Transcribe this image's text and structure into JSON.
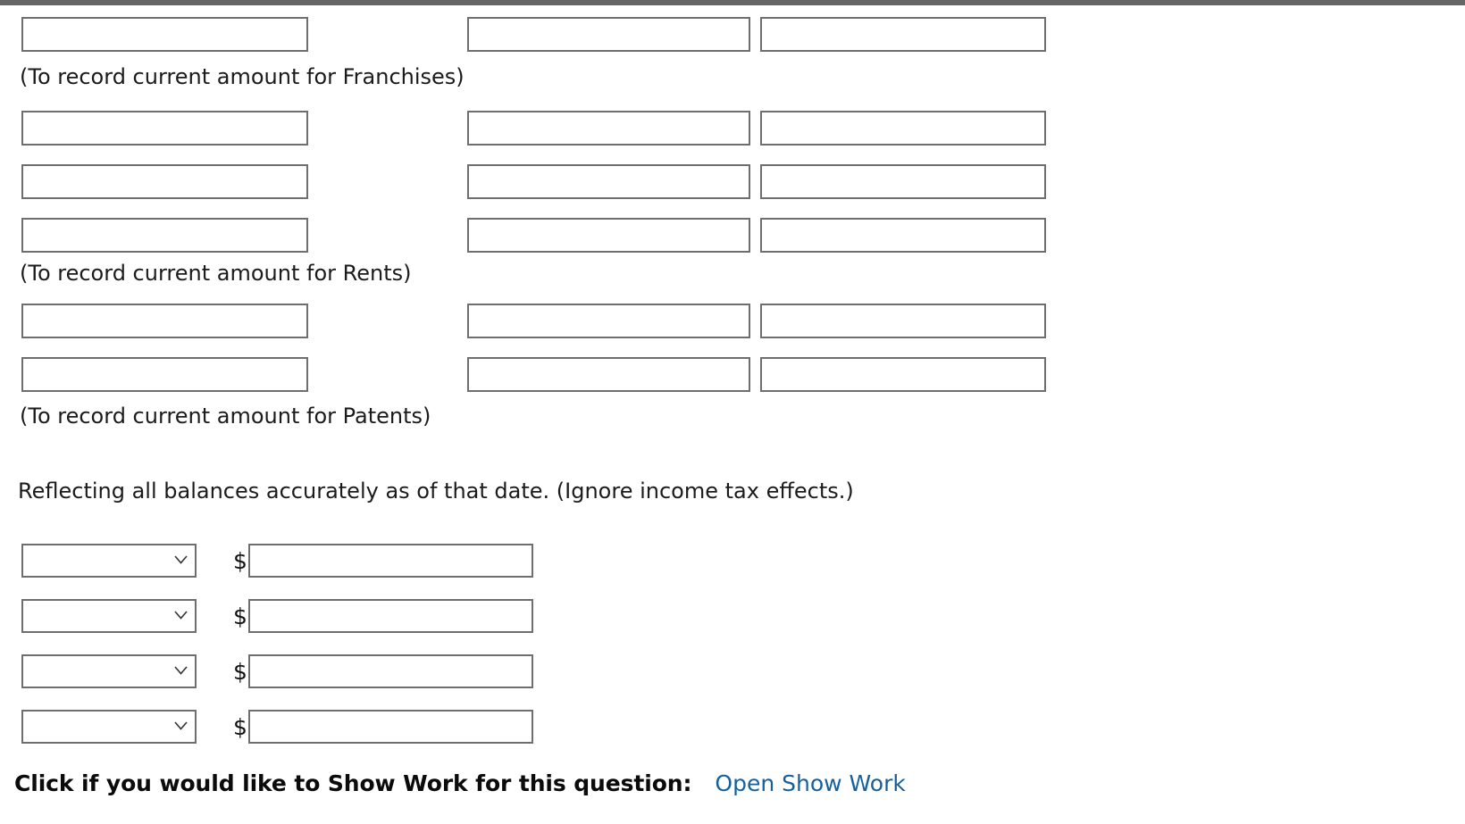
{
  "theme": {
    "top_bar_color": "#666666",
    "field_border_color": "#6e6e6e",
    "page_background": "#ffffff",
    "text_color": "#1b1b1b",
    "link_color": "#16619d"
  },
  "journal": {
    "columns": [
      "account",
      "debit",
      "credit"
    ],
    "groups": [
      {
        "id": "franchises",
        "rows": [
          {
            "account": "",
            "debit": "",
            "credit": ""
          }
        ],
        "caption": "(To record current amount for Franchises)"
      },
      {
        "id": "rents",
        "rows": [
          {
            "account": "",
            "debit": "",
            "credit": ""
          },
          {
            "account": "",
            "debit": "",
            "credit": ""
          },
          {
            "account": "",
            "debit": "",
            "credit": ""
          }
        ],
        "caption": "(To record current amount for Rents)"
      },
      {
        "id": "patents",
        "rows": [
          {
            "account": "",
            "debit": "",
            "credit": ""
          },
          {
            "account": "",
            "debit": "",
            "credit": ""
          }
        ],
        "caption": "(To record current amount for Patents)"
      }
    ]
  },
  "narrative": {
    "text": "Reflecting all balances accurately as of that date. (Ignore income tax effects.)"
  },
  "balance_section": {
    "currency_symbol": "$",
    "select_placeholder": "",
    "rows": [
      {
        "category": "",
        "amount": ""
      },
      {
        "category": "",
        "amount": ""
      },
      {
        "category": "",
        "amount": ""
      },
      {
        "category": "",
        "amount": ""
      }
    ]
  },
  "footer": {
    "show_work_label": "Click if you would like to Show Work for this question:",
    "show_work_link": "Open Show Work"
  }
}
